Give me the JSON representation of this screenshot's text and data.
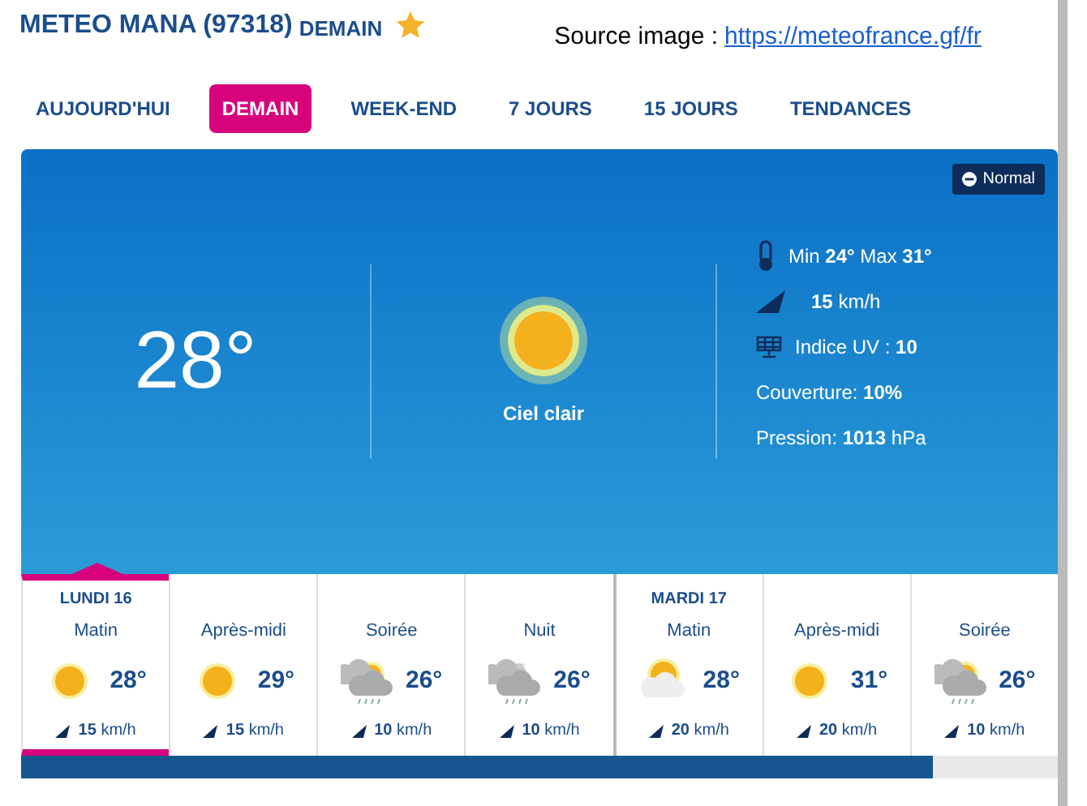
{
  "header": {
    "title": "METEO MANA (97318)",
    "subtitle": "DEMAIN",
    "favorite": true
  },
  "source": {
    "label": "Source image :",
    "link": "https://meteofrance.gf/fr"
  },
  "tabs": [
    {
      "label": "AUJOURD'HUI",
      "selected": false
    },
    {
      "label": "DEMAIN",
      "selected": true
    },
    {
      "label": "WEEK-END",
      "selected": false
    },
    {
      "label": "7 JOURS",
      "selected": false
    },
    {
      "label": "15 JOURS",
      "selected": false
    },
    {
      "label": "TENDANCES",
      "selected": false
    }
  ],
  "current": {
    "badge": "Normal",
    "temperature": "28°",
    "sky": "Ciel clair",
    "details": [
      {
        "kind": "thermo",
        "text": "Min **24°** Max **31°**"
      },
      {
        "kind": "wind",
        "text": "**15** km/h"
      },
      {
        "kind": "uv",
        "text": "Indice UV : **10**"
      },
      {
        "kind": "plain",
        "text": "Couverture: **10%**"
      },
      {
        "kind": "plain",
        "text": "Pression: **1013** hPa"
      }
    ]
  },
  "forecast": [
    {
      "day": "LUNDI 16",
      "period": "Matin",
      "kind": "sun",
      "temp": "28°",
      "wind": "15",
      "unit": "km/h",
      "selected": true
    },
    {
      "period": "Après-midi",
      "kind": "sun",
      "temp": "29°",
      "wind": "15",
      "unit": "km/h",
      "selected": false
    },
    {
      "period": "Soirée",
      "kind": "sun-cloud-rain",
      "temp": "26°",
      "wind": "10",
      "unit": "km/h",
      "selected": false
    },
    {
      "period": "Nuit",
      "kind": "moon-cloud-rain",
      "temp": "26°",
      "wind": "10",
      "unit": "km/h",
      "selected": false
    },
    {
      "day": "MARDI 17",
      "period": "Matin",
      "kind": "sun-cloud",
      "temp": "28°",
      "wind": "20",
      "unit": "km/h",
      "selected": false
    },
    {
      "period": "Après-midi",
      "kind": "sun",
      "temp": "31°",
      "wind": "20",
      "unit": "km/h",
      "selected": false
    },
    {
      "period": "Soirée",
      "kind": "sun-cloud-rain",
      "temp": "26°",
      "wind": "10",
      "unit": "km/h",
      "selected": false
    }
  ]
}
